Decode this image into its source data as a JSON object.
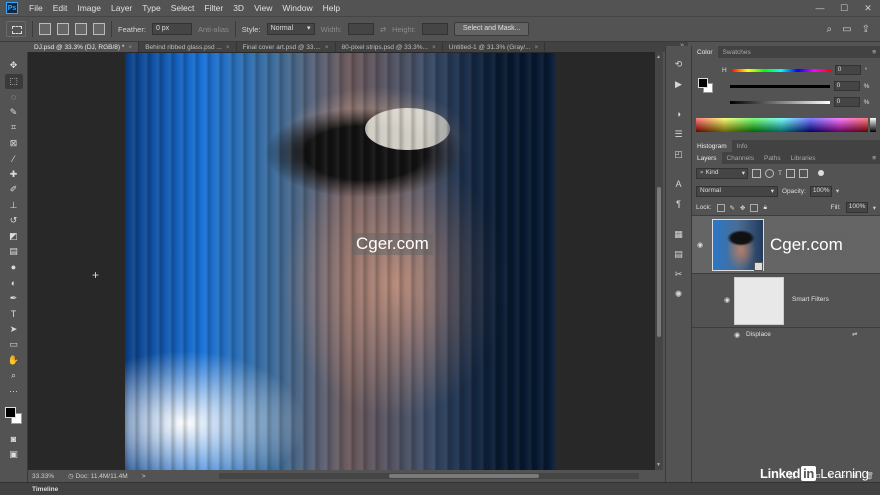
{
  "menu": [
    "File",
    "Edit",
    "Image",
    "Layer",
    "Type",
    "Select",
    "Filter",
    "3D",
    "View",
    "Window",
    "Help"
  ],
  "app_icon": "Ps",
  "window_controls": [
    "—",
    "☐",
    "✕"
  ],
  "options": {
    "feather_label": "Feather:",
    "feather_value": "0 px",
    "anti_alias_label": "Anti-alias",
    "style_label": "Style:",
    "style_value": "Normal",
    "width_label": "Width:",
    "height_label": "Height:",
    "select_mask_label": "Select and Mask..."
  },
  "tabs": [
    {
      "label": "DJ.psd @ 33.3% (DJ, RGB/8) *",
      "active": true
    },
    {
      "label": "Behind ribbed glass.psd ...",
      "active": false
    },
    {
      "label": "Final cover art.psd @ 33....",
      "active": false
    },
    {
      "label": "80-pixel strips.psd @ 33.3%...",
      "active": false
    },
    {
      "label": "Untitled-1 @ 31.3% (Gray/...",
      "active": false
    }
  ],
  "tabs_more": "»",
  "status": {
    "zoom": "33.33%",
    "doc": "Doc: 11.4M/11.4M",
    "arrow": ">"
  },
  "timeline_label": "Timeline",
  "watermark": "Cger.com",
  "color_panel": {
    "tabs": [
      "Color",
      "Swatches"
    ],
    "h_label": "H",
    "h_value": "0",
    "s_value": "0",
    "b_value": "0",
    "h_unit": "°",
    "s_unit": "%",
    "b_unit": "%"
  },
  "histogram_tabs": [
    "Histogram",
    "Info"
  ],
  "layers_panel": {
    "tabs": [
      "Layers",
      "Channels",
      "Paths",
      "Libraries"
    ],
    "kind": "Kind",
    "blend_mode": "Normal",
    "opacity_label": "Opacity:",
    "opacity_value": "100%",
    "lock_label": "Lock:",
    "fill_label": "Fill:",
    "fill_value": "100%",
    "smart_filters_label": "Smart Filters",
    "displace_label": "Displace"
  },
  "brand": {
    "part1": "Linked",
    "part2": "in",
    "part3": "Learning"
  },
  "colors": {
    "ui_bg": "#535353",
    "canvas_bg": "#282828",
    "accent": "#31a8ff"
  }
}
